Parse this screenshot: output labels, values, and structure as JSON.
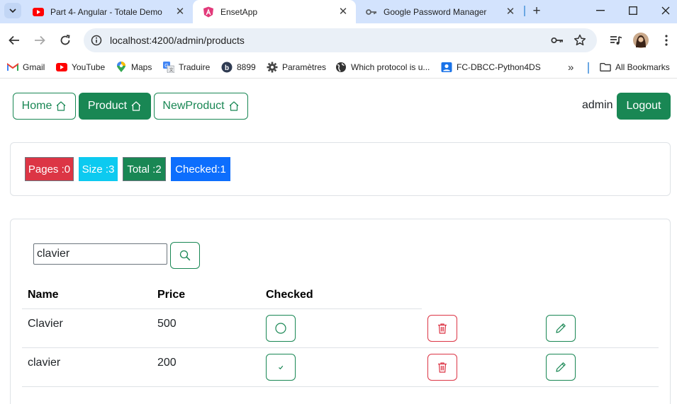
{
  "browser": {
    "tabs": [
      {
        "title": "Part 4- Angular - Totale Demo",
        "active": false
      },
      {
        "title": "EnsetApp",
        "active": true
      },
      {
        "title": "Google Password Manager",
        "active": false
      }
    ],
    "url": "localhost:4200/admin/products",
    "bookmarks": [
      {
        "label": "Gmail",
        "icon": "gmail-icon"
      },
      {
        "label": "YouTube",
        "icon": "youtube-icon"
      },
      {
        "label": "Maps",
        "icon": "maps-icon"
      },
      {
        "label": "Traduire",
        "icon": "translate-icon"
      },
      {
        "label": "8899",
        "icon": "b-circle-icon"
      },
      {
        "label": "Paramètres",
        "icon": "gear-icon"
      },
      {
        "label": "Which protocol is u...",
        "icon": "globe-icon"
      },
      {
        "label": "FC-DBCC-Python4DS",
        "icon": "profile-card-icon"
      }
    ],
    "all_bookmarks": "All Bookmarks"
  },
  "nav": {
    "home": "Home",
    "product": "Product",
    "new_product": "NewProduct",
    "username": "admin",
    "logout": "Logout"
  },
  "stats": {
    "pages": "Pages :0",
    "size": "Size :3",
    "total": "Total :2",
    "checked": "Checked:1"
  },
  "search": {
    "value": "clavier"
  },
  "table": {
    "headers": {
      "name": "Name",
      "price": "Price",
      "checked": "Checked"
    },
    "rows": [
      {
        "name": "Clavier",
        "price": "500",
        "checked": false
      },
      {
        "name": "clavier",
        "price": "200",
        "checked": true
      }
    ]
  },
  "colors": {
    "success": "#198754",
    "danger": "#dc3545",
    "info": "#0dcaf0",
    "primary": "#0d6efd"
  }
}
